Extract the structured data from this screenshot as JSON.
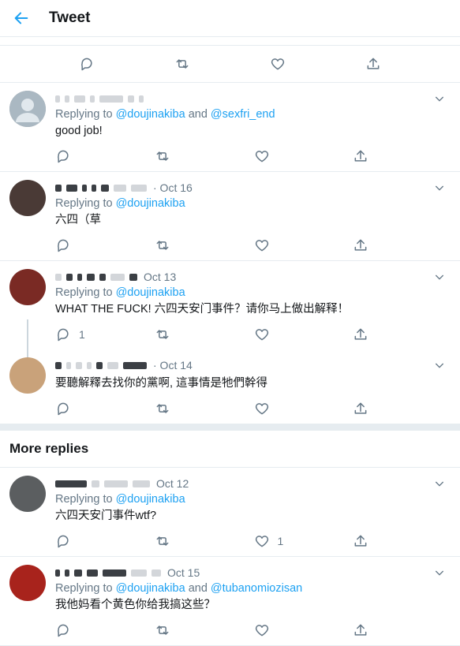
{
  "header": {
    "title": "Tweet"
  },
  "more_replies_label": "More replies",
  "tweets": [
    {
      "date": "",
      "reply_prefix": "Replying to ",
      "mentions": [
        "@doujinakiba",
        "@sexfri_end"
      ],
      "joiner": " and ",
      "text": "good job!",
      "reply_count": "",
      "like_count": "",
      "avatar_color": "#9aa1a8"
    },
    {
      "date": "· Oct 16",
      "reply_prefix": "Replying to ",
      "mentions": [
        "@doujinakiba"
      ],
      "joiner": "",
      "text": "六四（草",
      "reply_count": "",
      "like_count": "",
      "avatar_color": "#4a3a36"
    },
    {
      "date": "Oct 13",
      "reply_prefix": "Replying to ",
      "mentions": [
        "@doujinakiba"
      ],
      "joiner": "",
      "text": "WHAT THE FUCK! 六四天安门事件？请你马上做出解释！",
      "reply_count": "1",
      "like_count": "",
      "avatar_color": "#7a2a24"
    },
    {
      "date": "· Oct 14",
      "reply_prefix": "",
      "mentions": [],
      "joiner": "",
      "text": "要聽解釋去找你的黨啊, 這事情是牠們幹得",
      "reply_count": "",
      "like_count": "",
      "avatar_color": "#c9a27a"
    },
    {
      "date": "Oct 12",
      "reply_prefix": "Replying to ",
      "mentions": [
        "@doujinakiba"
      ],
      "joiner": "",
      "text": "六四天安门事件wtf?",
      "reply_count": "",
      "like_count": "1",
      "avatar_color": "#5b5e60"
    },
    {
      "date": "Oct 15",
      "reply_prefix": "Replying to ",
      "mentions": [
        "@doujinakiba",
        "@tubanomiozisan"
      ],
      "joiner": " and ",
      "text": "我他妈看个黄色你给我搞这些？",
      "reply_count": "",
      "like_count": "",
      "avatar_color": "#a8231c"
    }
  ]
}
